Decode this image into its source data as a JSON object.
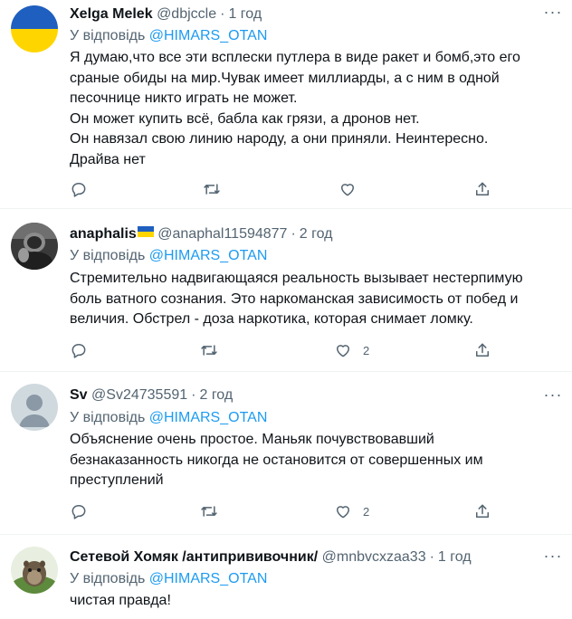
{
  "tweets": [
    {
      "name": "Xelga Melek",
      "handle": "@dbjccle",
      "separator": "·",
      "time": "1 год",
      "reply_prefix": "У відповідь",
      "reply_to": "@HIMARS_OTAN",
      "text_lines": [
        "Я думаю,что все эти всплески путлера в виде ракет и бомб,это его",
        "сраные обиды на мир.Чувак имеет миллиарды, а с ним в одной",
        "песочнице никто играть не может.",
        "Он может купить всё, бабла как грязи, а дронов нет.",
        "Он навязал свою линию народу, а они приняли. Неинтересно.",
        "Драйва нет"
      ],
      "likes": ""
    },
    {
      "name": "anaphalis",
      "handle": "@anaphal11594877",
      "separator": "·",
      "time": "2 год",
      "reply_prefix": "У відповідь",
      "reply_to": "@HIMARS_OTAN",
      "text_lines": [
        "Стремительно надвигающаяся реальность вызывает нестерпимую",
        "боль ватного сознания. Это наркоманская зависимость от побед и",
        "величия. Обстрел - доза наркотика, которая снимает ломку."
      ],
      "likes": "2"
    },
    {
      "name": "Sv",
      "handle": "@Sv24735591",
      "separator": "·",
      "time": "2 год",
      "reply_prefix": "У відповідь",
      "reply_to": "@HIMARS_OTAN",
      "text_lines": [
        "Объяснение очень простое.  Маньяк почувствовавший",
        "безнаказанность никогда не остановится от совершенных им",
        "преступлений"
      ],
      "likes": "2"
    },
    {
      "name": "Сетевой Хомяк /антипрививочник/",
      "handle": "@mnbvcxzaa33",
      "separator": "·",
      "time": "1 год",
      "reply_prefix": "У відповідь",
      "reply_to": "@HIMARS_OTAN",
      "text_lines": [
        "чистая правда!"
      ]
    }
  ],
  "colors": {
    "text": "#0f1419",
    "secondary": "#536471",
    "link": "#1d9bf0",
    "divider": "#eff3f4",
    "flag_blue": "#1f5fbf",
    "flag_yellow": "#ffd500"
  },
  "icons": {
    "reply": "speech-bubble-icon",
    "retweet": "retweet-icon",
    "like": "heart-icon",
    "share": "share-icon",
    "more": "more-dots-icon",
    "flag": "ukraine-flag-icon"
  }
}
